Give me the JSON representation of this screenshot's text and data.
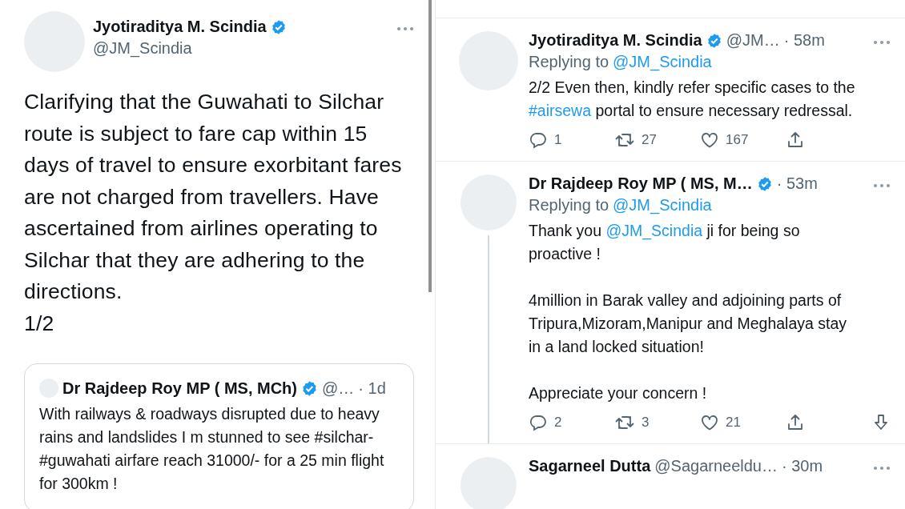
{
  "main_tweet": {
    "author": {
      "name": "Jyotiraditya M. Scindia",
      "verified": true,
      "handle": "@JM_Scindia"
    },
    "body": "Clarifying that the Guwahati to Silchar route is subject to fare cap within 15 days of travel to ensure exorbitant fares are not charged from travellers. Have ascertained from airlines operating to Silchar that they are adhering to the directions.\n1/2",
    "quoted_tweet": {
      "name": "Dr Rajdeep Roy MP ( MS, MCh)",
      "verified": true,
      "handle": "@…",
      "time": "· 1d",
      "body": "With railways & roadways disrupted due to heavy rains and landslides I m stunned to see #silchar-#guwahati airfare reach 31000/- for a 25 min flight for 300km !"
    }
  },
  "replies": [
    {
      "name": "Jyotiraditya M. Scindia",
      "verified": true,
      "handle": "@JM…",
      "time": "· 58m",
      "thread_line": false,
      "replying_label": "Replying to",
      "replying_to": "@JM_Scindia",
      "body": [
        {
          "kind": "text",
          "text": "2/2 Even then, kindly refer specific cases to the "
        },
        {
          "kind": "link",
          "text": "#airsewa"
        },
        {
          "kind": "text",
          "text": " portal to ensure necessary redressal."
        }
      ],
      "actions": [
        {
          "kind": "reply",
          "count": "1"
        },
        {
          "kind": "retweet",
          "count": "27"
        },
        {
          "kind": "like",
          "count": "167"
        },
        {
          "kind": "share"
        }
      ]
    },
    {
      "name": "Dr Rajdeep Roy MP ( MS, M…",
      "verified": true,
      "time": "· 53m",
      "thread_line": true,
      "replying_label": "Replying to",
      "replying_to": "@JM_Scindia",
      "body": [
        {
          "kind": "text",
          "text": "Thank you "
        },
        {
          "kind": "link",
          "text": "@JM_Scindia"
        },
        {
          "kind": "text",
          "text": " ji for being so proactive !\n\n4million in Barak valley and adjoining parts of Tripura,Mizoram,Manipur and Meghalaya stay in a land locked situation!\n\nAppreciate your concern !"
        }
      ],
      "actions": [
        {
          "kind": "reply",
          "count": "2"
        },
        {
          "kind": "retweet",
          "count": "3"
        },
        {
          "kind": "like",
          "count": "21"
        },
        {
          "kind": "share"
        },
        {
          "kind": "download"
        }
      ]
    },
    {
      "name": "Sagarneel Dutta",
      "verified": false,
      "handle": "@Sagarneeldu…",
      "time": "· 30m",
      "thread_line": false
    }
  ]
}
